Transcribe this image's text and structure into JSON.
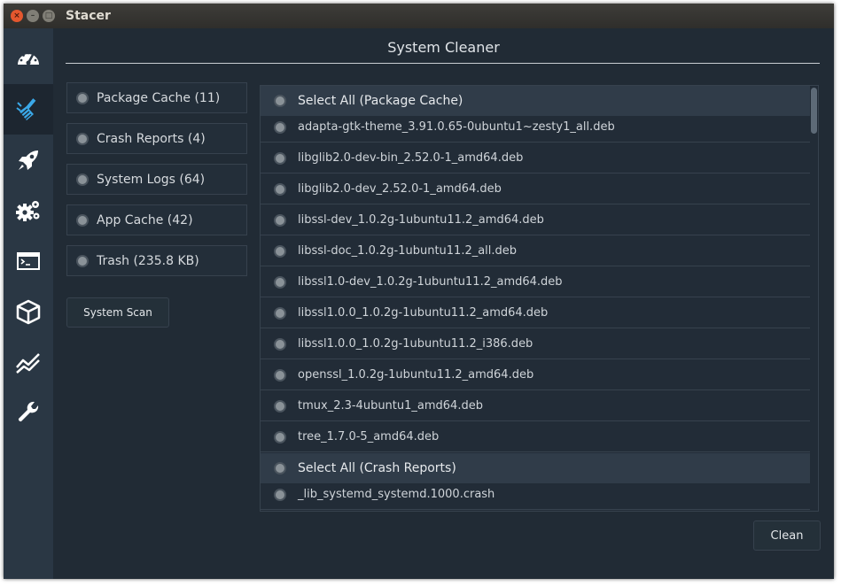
{
  "window": {
    "title": "Stacer"
  },
  "sidebar": {
    "items": [
      {
        "icon": "dashboard-icon"
      },
      {
        "icon": "broom-icon",
        "active": true
      },
      {
        "icon": "rocket-icon"
      },
      {
        "icon": "gears-icon"
      },
      {
        "icon": "terminal-icon"
      },
      {
        "icon": "package-icon"
      },
      {
        "icon": "chart-icon"
      },
      {
        "icon": "wrench-icon"
      }
    ]
  },
  "main": {
    "title": "System Cleaner",
    "categories": [
      {
        "label": "Package Cache (11)"
      },
      {
        "label": "Crash Reports (4)"
      },
      {
        "label": "System Logs (64)"
      },
      {
        "label": "App Cache (42)"
      },
      {
        "label": "Trash (235.8 KB)"
      }
    ],
    "scan_button": "System Scan",
    "clean_button": "Clean",
    "list": [
      {
        "label": "Select All (Package Cache)",
        "header": true
      },
      {
        "label": "adapta-gtk-theme_3.91.0.65-0ubuntu1~zesty1_all.deb"
      },
      {
        "label": "libglib2.0-dev-bin_2.52.0-1_amd64.deb"
      },
      {
        "label": "libglib2.0-dev_2.52.0-1_amd64.deb"
      },
      {
        "label": "libssl-dev_1.0.2g-1ubuntu11.2_amd64.deb"
      },
      {
        "label": "libssl-doc_1.0.2g-1ubuntu11.2_all.deb"
      },
      {
        "label": "libssl1.0-dev_1.0.2g-1ubuntu11.2_amd64.deb"
      },
      {
        "label": "libssl1.0.0_1.0.2g-1ubuntu11.2_amd64.deb"
      },
      {
        "label": "libssl1.0.0_1.0.2g-1ubuntu11.2_i386.deb"
      },
      {
        "label": "openssl_1.0.2g-1ubuntu11.2_amd64.deb"
      },
      {
        "label": "tmux_2.3-4ubuntu1_amd64.deb"
      },
      {
        "label": "tree_1.7.0-5_amd64.deb"
      },
      {
        "label": "Select All (Crash Reports)",
        "header": true
      },
      {
        "label": "_lib_systemd_systemd.1000.crash"
      }
    ]
  },
  "colors": {
    "window_bg": "#232d38",
    "sidebar_bg": "#2a3744",
    "sidebar_active": "#1d2630",
    "header_row": "#303c49",
    "text": "#d6dade"
  }
}
